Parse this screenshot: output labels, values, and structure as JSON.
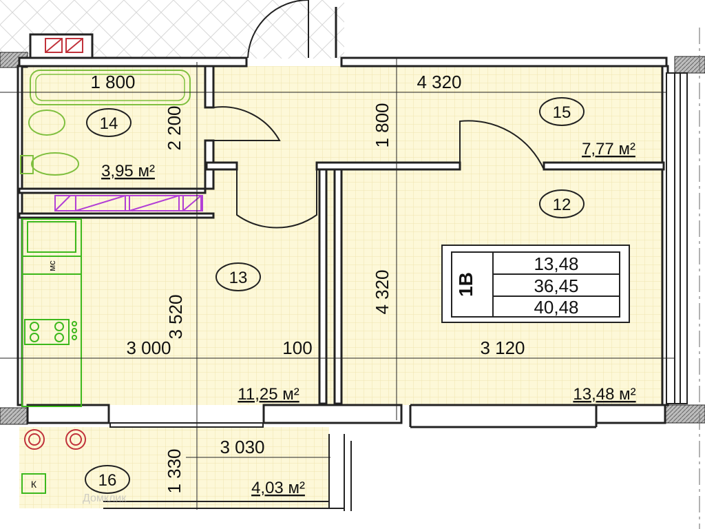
{
  "rooms": [
    {
      "id": "room-14",
      "number": "14",
      "area": "3,95 м²"
    },
    {
      "id": "room-15",
      "number": "15",
      "area": "7,77 м²"
    },
    {
      "id": "room-12",
      "number": "12",
      "area": "13,48 м²"
    },
    {
      "id": "room-13",
      "number": "13",
      "area": "11,25 м²"
    },
    {
      "id": "room-16",
      "number": "16",
      "area": "4,03 м²"
    }
  ],
  "dimensions": {
    "bath_width": "1 800",
    "hall_width": "4 320",
    "bath_depth": "2 200",
    "hall_depth": "1 800",
    "kitchen_depth": "3 520",
    "room_depth": "4 320",
    "kitchen_width": "3 000",
    "wall_gap": "100",
    "room_width": "3 120",
    "balcony_width": "3 030",
    "balcony_depth": "1 330"
  },
  "summary": {
    "apartment_type": "1В",
    "living_area": "13,48",
    "total_area_1": "36,45",
    "total_area_2": "40,48"
  },
  "fixtures": {
    "dishwasher_label": "мс",
    "k_label": "К"
  },
  "watermark": "Домклик",
  "colors": {
    "floor": "#fdf8d8",
    "grid": "#f0e6b0",
    "wall": "#222222",
    "kitchen_fixtures": "#3cb81c",
    "wardrobe": "#b23fd6",
    "stove_balcony": "#c0313a",
    "bath_fixtures": "#7fbf3f"
  }
}
